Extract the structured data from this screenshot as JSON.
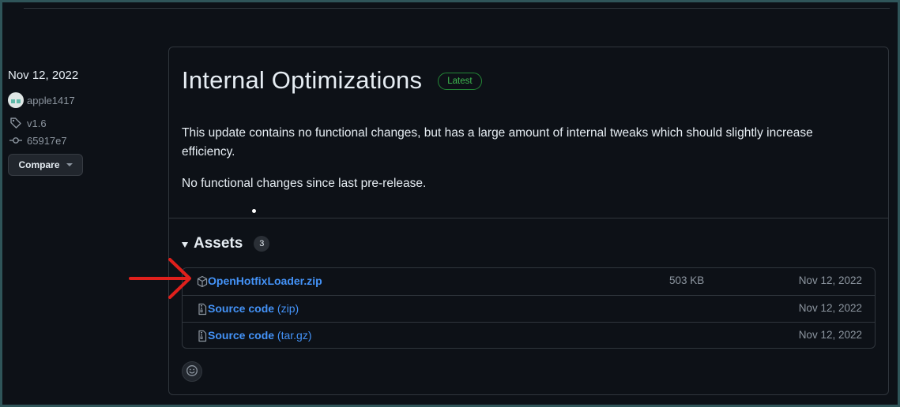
{
  "sidebar": {
    "date": "Nov 12, 2022",
    "author": "apple1417",
    "tag": "v1.6",
    "commit": "65917e7",
    "compare_label": "Compare"
  },
  "release": {
    "title": "Internal Optimizations",
    "badge": "Latest",
    "body": [
      "This update contains no functional changes, but has a large amount of internal tweaks which should slightly increase efficiency.",
      "No functional changes since last pre-release."
    ]
  },
  "assets": {
    "title": "Assets",
    "count": "3",
    "items": [
      {
        "name": "OpenHotfixLoader.zip",
        "suffix": "",
        "size": "503 KB",
        "date": "Nov 12, 2022",
        "icon": "package-icon"
      },
      {
        "name": "Source code",
        "suffix": " (zip)",
        "size": "",
        "date": "Nov 12, 2022",
        "icon": "file-zip-icon"
      },
      {
        "name": "Source code",
        "suffix": " (tar.gz)",
        "size": "",
        "date": "Nov 12, 2022",
        "icon": "file-zip-icon"
      }
    ]
  },
  "colors": {
    "background": "#0d1117",
    "link": "#4493f8",
    "latest_badge": "#3fb950",
    "annotation_arrow": "#e0201c",
    "frame": "#2f5559"
  }
}
